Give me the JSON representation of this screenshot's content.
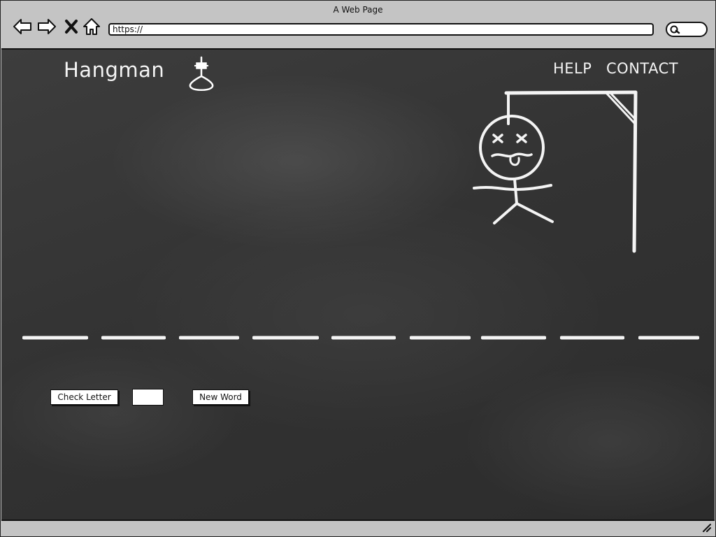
{
  "window": {
    "title": "A Web Page"
  },
  "browser": {
    "back_icon": "back-arrow-icon",
    "forward_icon": "forward-arrow-icon",
    "stop_icon": "close-x-icon",
    "home_icon": "home-icon",
    "address_value": "https://",
    "search_icon": "search-icon"
  },
  "header": {
    "logo": "Hangman",
    "logo_icon": "noose-icon",
    "nav": [
      {
        "label": "HELP"
      },
      {
        "label": "CONTACT"
      }
    ]
  },
  "game": {
    "drawing": "hangman-gallows-drawing",
    "blank_count": 9,
    "check_letter_label": "Check Letter",
    "letter_value": "",
    "new_word_label": "New Word"
  },
  "colors": {
    "chalkboard": "#363636",
    "chalk": "#f4f4f4",
    "browser_chrome": "#c4c4c4"
  }
}
